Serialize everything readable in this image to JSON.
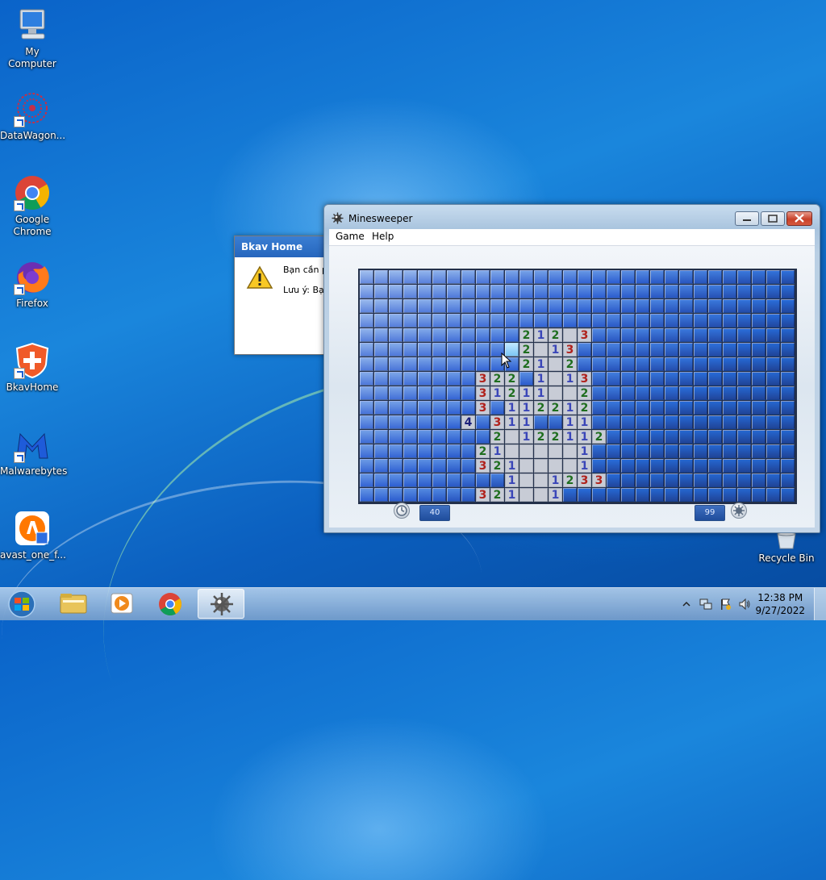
{
  "desktop": {
    "icons": [
      {
        "label": "My Computer"
      },
      {
        "label": "DataWagon..."
      },
      {
        "label": "Google Chrome"
      },
      {
        "label": "Firefox"
      },
      {
        "label": "BkavHome"
      },
      {
        "label": "Malwarebytes"
      },
      {
        "label": "avast_one_f..."
      },
      {
        "label": "Recycle Bin"
      }
    ]
  },
  "bkav_dialog": {
    "title": "Bkav Home",
    "line1": "Bạn cần ph",
    "line2": "Lưu ý: Bạn",
    "icon": "warning-icon"
  },
  "minesweeper": {
    "title": "Minesweeper",
    "menu": [
      "Game",
      "Help"
    ],
    "time": "40",
    "mines": "99",
    "grid": {
      "cols": 30,
      "rows": 16,
      "opened": [
        [
          4,
          11,
          "2"
        ],
        [
          4,
          12,
          "1"
        ],
        [
          4,
          13,
          "2"
        ],
        [
          4,
          14,
          ""
        ],
        [
          4,
          15,
          "3"
        ],
        [
          5,
          11,
          "2"
        ],
        [
          5,
          12,
          ""
        ],
        [
          5,
          13,
          "1"
        ],
        [
          5,
          14,
          "3"
        ],
        [
          6,
          11,
          "2"
        ],
        [
          6,
          12,
          "1"
        ],
        [
          6,
          13,
          ""
        ],
        [
          6,
          14,
          "2"
        ],
        [
          7,
          8,
          "3"
        ],
        [
          7,
          9,
          "2"
        ],
        [
          7,
          10,
          "2"
        ],
        [
          7,
          12,
          "1"
        ],
        [
          7,
          13,
          ""
        ],
        [
          7,
          14,
          "1"
        ],
        [
          7,
          15,
          "3"
        ],
        [
          8,
          8,
          "3"
        ],
        [
          8,
          9,
          "1"
        ],
        [
          8,
          10,
          "2"
        ],
        [
          8,
          11,
          "1"
        ],
        [
          8,
          12,
          "1"
        ],
        [
          8,
          13,
          ""
        ],
        [
          8,
          14,
          ""
        ],
        [
          8,
          15,
          "2"
        ],
        [
          9,
          8,
          "3"
        ],
        [
          9,
          10,
          "1"
        ],
        [
          9,
          11,
          "1"
        ],
        [
          9,
          12,
          "2"
        ],
        [
          9,
          13,
          "2"
        ],
        [
          9,
          14,
          "1"
        ],
        [
          9,
          15,
          "2"
        ],
        [
          10,
          7,
          "4"
        ],
        [
          10,
          9,
          "3"
        ],
        [
          10,
          10,
          "1"
        ],
        [
          10,
          11,
          "1"
        ],
        [
          10,
          14,
          "1"
        ],
        [
          10,
          15,
          "1"
        ],
        [
          11,
          9,
          "2"
        ],
        [
          11,
          10,
          ""
        ],
        [
          11,
          11,
          "1"
        ],
        [
          11,
          12,
          "2"
        ],
        [
          11,
          13,
          "2"
        ],
        [
          11,
          14,
          "1"
        ],
        [
          11,
          15,
          "1"
        ],
        [
          11,
          16,
          "2"
        ],
        [
          12,
          8,
          "2"
        ],
        [
          12,
          9,
          "1"
        ],
        [
          12,
          10,
          ""
        ],
        [
          12,
          11,
          ""
        ],
        [
          12,
          12,
          ""
        ],
        [
          12,
          13,
          ""
        ],
        [
          12,
          14,
          ""
        ],
        [
          12,
          15,
          "1"
        ],
        [
          13,
          8,
          "3"
        ],
        [
          13,
          9,
          "2"
        ],
        [
          13,
          10,
          "1"
        ],
        [
          13,
          11,
          ""
        ],
        [
          13,
          12,
          ""
        ],
        [
          13,
          13,
          ""
        ],
        [
          13,
          14,
          ""
        ],
        [
          13,
          15,
          "1"
        ],
        [
          14,
          10,
          "1"
        ],
        [
          14,
          11,
          ""
        ],
        [
          14,
          12,
          ""
        ],
        [
          14,
          13,
          "1"
        ],
        [
          14,
          14,
          "2"
        ],
        [
          14,
          15,
          "3"
        ],
        [
          14,
          16,
          "3"
        ],
        [
          15,
          8,
          "3"
        ],
        [
          15,
          9,
          "2"
        ],
        [
          15,
          10,
          "1"
        ],
        [
          15,
          11,
          ""
        ],
        [
          15,
          12,
          ""
        ],
        [
          15,
          13,
          "1"
        ]
      ],
      "highlight": [
        5,
        10
      ]
    },
    "number_colors": {
      "1": "#3a46b8",
      "2": "#1f6e1f",
      "3": "#b0221c",
      "4": "#1b1f7a"
    }
  },
  "taskbar": {
    "items": [
      "windows-explorer",
      "media-player",
      "google-chrome",
      "minesweeper"
    ],
    "time": "12:38 PM",
    "date": "9/27/2022"
  }
}
